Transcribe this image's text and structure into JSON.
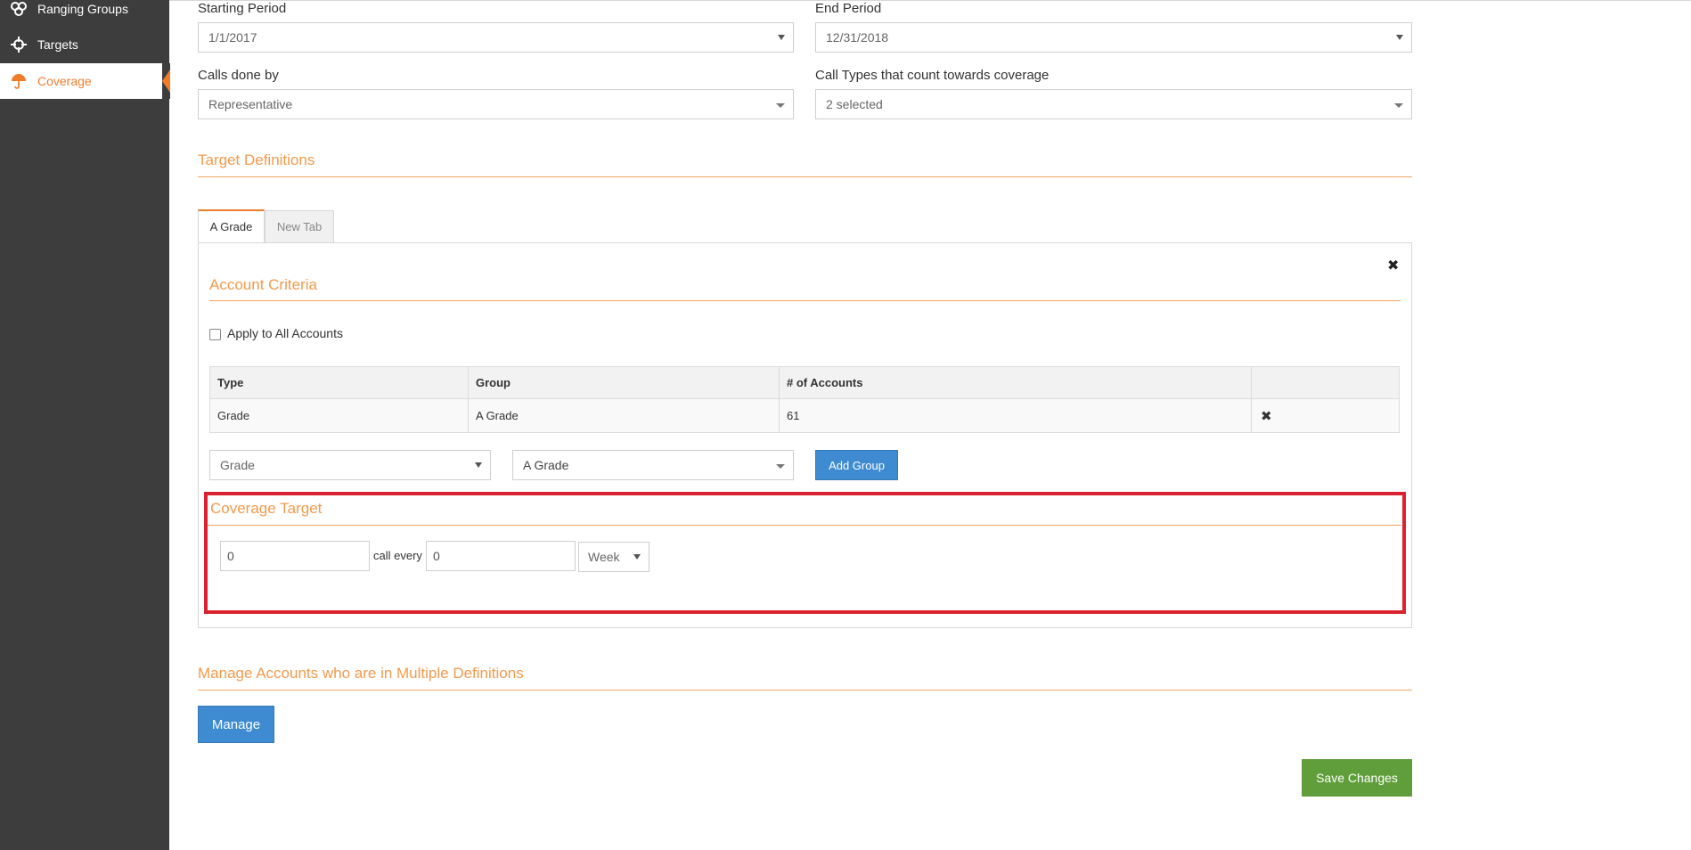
{
  "sidebar": {
    "items": [
      {
        "label": "Ranging Groups",
        "icon": "ranging-groups-icon"
      },
      {
        "label": "Targets",
        "icon": "targets-crosshair-icon"
      },
      {
        "label": "Coverage",
        "icon": "umbrella-icon",
        "active": true
      }
    ]
  },
  "filters": {
    "starting_period_label": "Starting Period",
    "starting_period_value": "1/1/2017",
    "end_period_label": "End Period",
    "end_period_value": "12/31/2018",
    "calls_done_by_label": "Calls done by",
    "calls_done_by_value": "Representative",
    "call_types_label": "Call Types that count towards coverage",
    "call_types_value": "2 selected"
  },
  "target_definitions": {
    "title": "Target Definitions",
    "tabs": [
      {
        "label": "A Grade",
        "active": true
      },
      {
        "label": "New Tab",
        "active": false
      }
    ],
    "account_criteria_title": "Account Criteria",
    "apply_all_label": "Apply to All Accounts",
    "table": {
      "headers": [
        "Type",
        "Group",
        "# of Accounts",
        ""
      ],
      "rows": [
        {
          "type": "Grade",
          "group": "A Grade",
          "accounts": "61"
        }
      ]
    },
    "type_select_value": "Grade",
    "group_select_value": "A Grade",
    "add_group_label": "Add Group",
    "coverage_target_title": "Coverage Target",
    "coverage_calls_value": "0",
    "call_every_label": "call every",
    "coverage_interval_value": "0",
    "coverage_unit_value": "Week"
  },
  "multiple_definitions": {
    "title": "Manage Accounts who are in Multiple Definitions",
    "manage_label": "Manage"
  },
  "save_label": "Save Changes",
  "colors": {
    "accent": "#f07c2a",
    "sidebar_bg": "#3d3d3d",
    "primary_button": "#3e8bd1",
    "save_button": "#5f9e3a",
    "highlight_border": "#d9232f"
  }
}
